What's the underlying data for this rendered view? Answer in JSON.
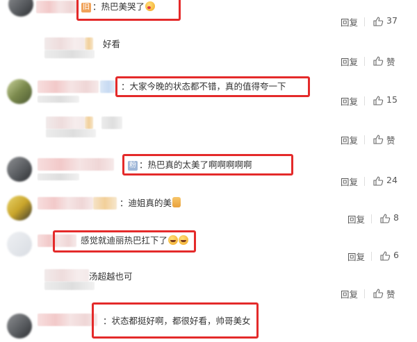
{
  "comments": [
    {
      "text": "热巴美哭了",
      "prefix": "：",
      "likes": "37"
    },
    {
      "text": "好看",
      "prefix": "",
      "likes": "赞"
    },
    {
      "text": "大家今晚的状态都不错，真的值得夸一下",
      "prefix": "：",
      "likes": "15"
    },
    {
      "text": "",
      "prefix": "",
      "likes": "赞"
    },
    {
      "text": "热巴真的太美了啊啊啊啊啊",
      "prefix": "：",
      "likes": "24"
    },
    {
      "text": "迪姐真的美",
      "prefix": "：",
      "likes": "8"
    },
    {
      "text": "感觉就迪丽热巴扛下了",
      "prefix": "",
      "likes": "6"
    },
    {
      "text": "汤超越也可",
      "prefix": "",
      "likes": "赞"
    },
    {
      "text": "状态都挺好啊，都很好看，帅哥美女",
      "prefix": "：",
      "likes": ""
    }
  ],
  "actions": {
    "reply_label": "回复",
    "like_icon": "thumbs-up-icon"
  },
  "colors": {
    "highlight": "#e42a2a",
    "text": "#333333",
    "action_text": "#555555"
  }
}
